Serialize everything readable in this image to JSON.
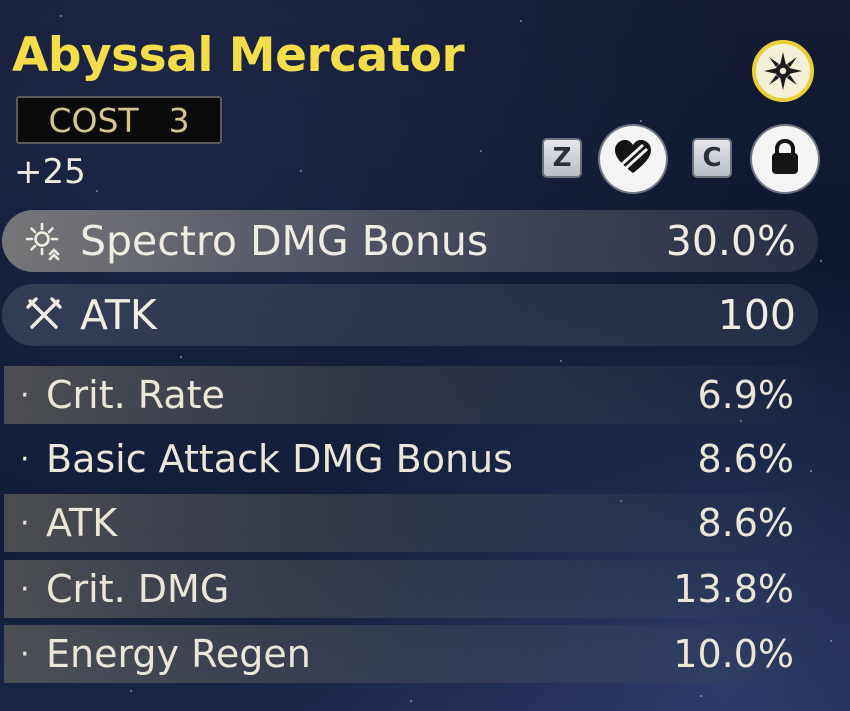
{
  "echo": {
    "name": "Abyssal Mercator",
    "cost_label": "COST",
    "cost_value": "3",
    "level": "+25",
    "sonata_icon": "sun-burst-icon"
  },
  "actions": {
    "discard_key": "Z",
    "discard_icon": "broken-heart-icon",
    "lock_key": "C",
    "lock_icon": "lock-icon"
  },
  "main_stats": [
    {
      "name": "Spectro DMG Bonus",
      "value": "30.0%",
      "icon": "spectro-element-icon"
    },
    {
      "name": "ATK",
      "value": "100",
      "icon": "crossed-swords-icon"
    }
  ],
  "sub_stats": {
    "bullet": "·",
    "items": [
      {
        "name": "Crit. Rate",
        "value": "6.9%"
      },
      {
        "name": "Basic Attack DMG Bonus",
        "value": "8.6%"
      },
      {
        "name": "ATK",
        "value": "8.6%"
      },
      {
        "name": "Crit. DMG",
        "value": "13.8%"
      },
      {
        "name": "Energy Regen",
        "value": "10.0%"
      }
    ]
  },
  "colors": {
    "title": "#f3dd4a",
    "cost_text": "#d4c48e",
    "text": "#ece6d8"
  }
}
